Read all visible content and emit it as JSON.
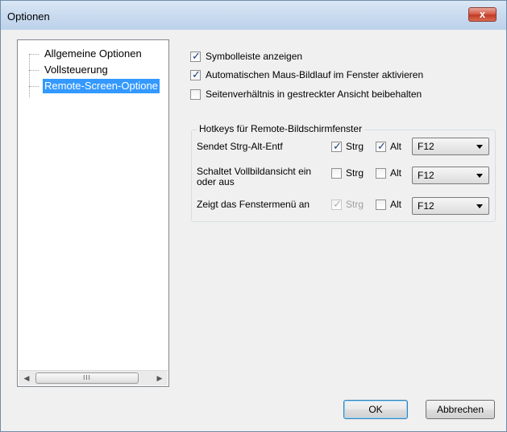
{
  "window": {
    "title": "Optionen",
    "close_glyph": "x"
  },
  "tree": {
    "items": [
      {
        "label": "Allgemeine Optionen"
      },
      {
        "label": "Vollsteuerung"
      },
      {
        "label": "Remote-Screen-Optione",
        "selected": true
      }
    ],
    "scroll_thumb": "III"
  },
  "options": {
    "show_toolbar": {
      "label": "Symbolleiste anzeigen",
      "checked": true
    },
    "auto_scroll": {
      "label": "Automatischen Maus-Bildlauf im Fenster aktivieren",
      "checked": true
    },
    "keep_ratio": {
      "label": "Seitenverhältnis in gestreckter Ansicht beibehalten",
      "checked": false
    }
  },
  "hotkeys": {
    "group_title": "Hotkeys für Remote-Bildschirmfenster",
    "ctrl_label": "Strg",
    "alt_label": "Alt",
    "rows": [
      {
        "label": "Sendet Strg-Alt-Entf",
        "ctrl": true,
        "alt": true,
        "key": "F12"
      },
      {
        "label": "Schaltet Vollbildansicht ein oder aus",
        "ctrl": false,
        "alt": false,
        "key": "F12"
      },
      {
        "label": "Zeigt das Fenstermenü an",
        "ctrl": true,
        "ctrl_disabled": true,
        "alt": false,
        "key": "F12"
      }
    ]
  },
  "buttons": {
    "ok": "OK",
    "cancel": "Abbrechen"
  },
  "colors": {
    "selection": "#3399ff",
    "close_button": "#c23b26"
  }
}
